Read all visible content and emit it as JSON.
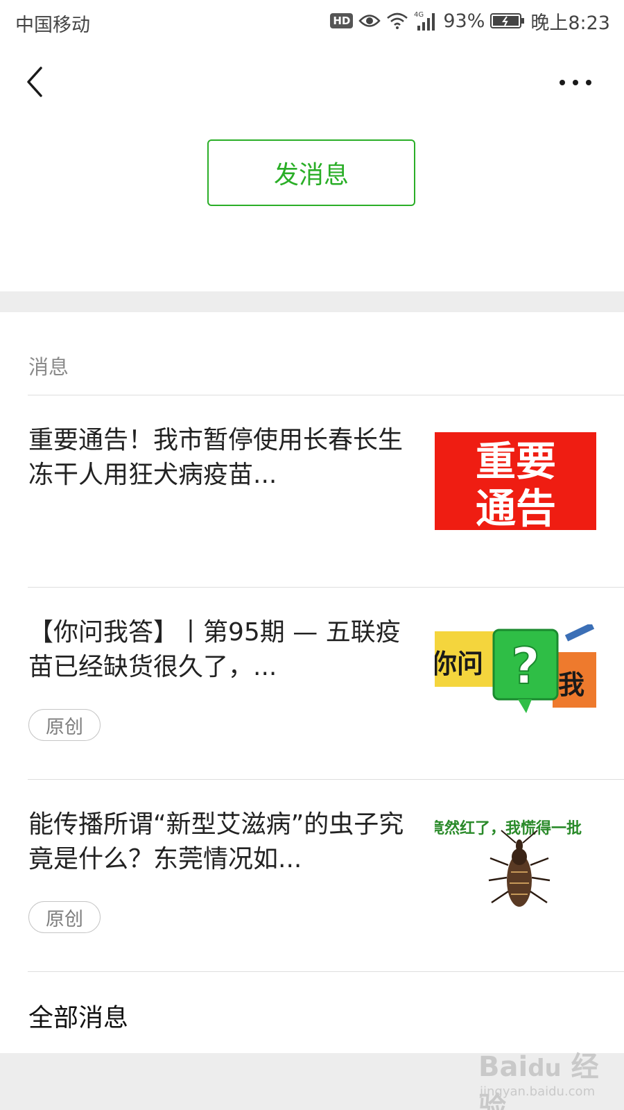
{
  "status_bar": {
    "carrier": "中国移动",
    "hd": "HD",
    "network": "4G",
    "battery": "93%",
    "time": "晚上8:23"
  },
  "nav": {
    "back_icon": "chevron-left-icon",
    "more_icon": "more-dots-icon"
  },
  "profile": {
    "send_message_label": "发消息"
  },
  "messages": {
    "section_label": "消息",
    "items": [
      {
        "title": "重要通告！我市暂停使用长春长生冻干人用狂犬病疫苗...",
        "thumb_text_line1": "重要",
        "thumb_text_line2": "通告",
        "tag": ""
      },
      {
        "title": "【你问我答】丨第95期 — 五联疫苗已经缺货很久了，...",
        "thumb_text_left": "你问",
        "thumb_text_q": "?",
        "thumb_text_right": "我",
        "tag": "原创"
      },
      {
        "title": "能传播所谓“新型艾滋病”的虫子究竟是什么？东莞情况如...",
        "thumb_caption": "竟然红了，我慌得一批",
        "tag": "原创"
      }
    ],
    "all_label": "全部消息"
  },
  "watermark": {
    "logo": "Bai du 经验",
    "url": "jingyan.baidu.com"
  },
  "colors": {
    "accent_green": "#2aae27",
    "alert_red": "#ef1d12"
  }
}
